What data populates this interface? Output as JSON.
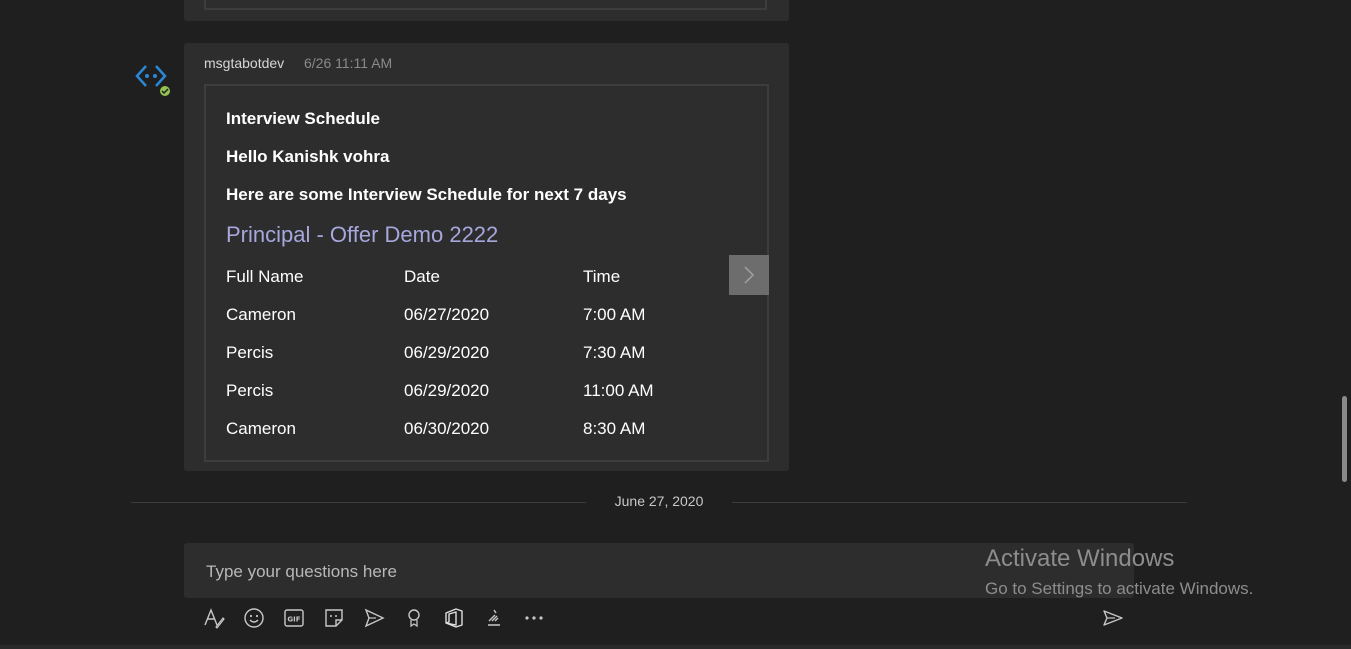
{
  "message": {
    "sender": "msgtabotdev",
    "timestamp": "6/26 11:11 AM"
  },
  "card": {
    "title": "Interview Schedule",
    "greeting": "Hello Kanishk vohra",
    "intro": "Here are some Interview Schedule for next 7 days",
    "job_title": "Principal - Offer Demo 2222",
    "columns": [
      "Full Name",
      "Date",
      "Time"
    ],
    "rows": [
      {
        "name": "Cameron",
        "date": "06/27/2020",
        "time": "7:00 AM"
      },
      {
        "name": "Percis",
        "date": "06/29/2020",
        "time": "7:30 AM"
      },
      {
        "name": "Percis",
        "date": "06/29/2020",
        "time": "11:00 AM"
      },
      {
        "name": "Cameron",
        "date": "06/30/2020",
        "time": "8:30 AM"
      }
    ],
    "next_icon": "chevron-right-icon"
  },
  "date_divider": "June 27, 2020",
  "compose": {
    "placeholder": "Type your questions here"
  },
  "watermark": {
    "title": "Activate Windows",
    "subtitle": "Go to Settings to activate Windows."
  },
  "toolbar": {
    "icons": [
      "format-icon",
      "emoji-icon",
      "gif-icon",
      "sticker-icon",
      "meet-now-icon",
      "praise-icon",
      "office-icon",
      "stream-icon",
      "more-options-icon",
      "send-icon"
    ]
  },
  "colors": {
    "background": "#1f1f1f",
    "message_bg": "#2d2d2d",
    "accent_link": "#a6a7dc",
    "status_available": "#92c353",
    "bot_icon": "#2b88d8"
  }
}
